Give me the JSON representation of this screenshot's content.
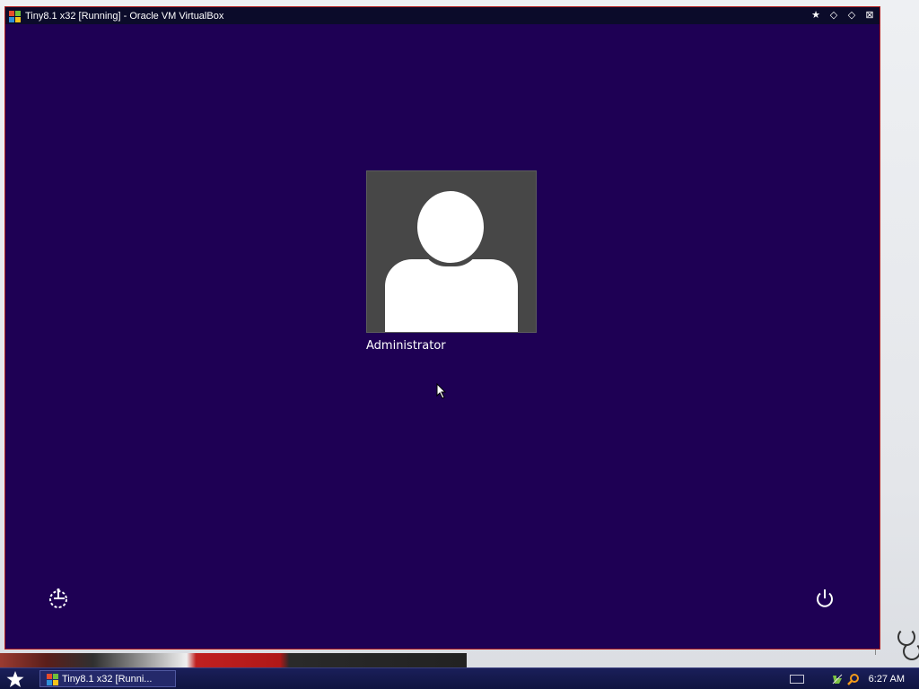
{
  "window": {
    "title": "Tiny8.1 x32 [Running] - Oracle VM VirtualBox",
    "buttons": [
      "pin-icon",
      "minimize-icon",
      "maximize-icon",
      "close-icon"
    ],
    "border_color": "#b11c1c"
  },
  "vm_screen": {
    "background_color": "#1e0054",
    "user": {
      "name": "Administrator",
      "avatar_icon": "user-silhouette-icon"
    },
    "bottom_left_icon": "ease-of-access-icon",
    "bottom_right_icon": "power-icon"
  },
  "taskbar": {
    "start_icon": "start-star-icon",
    "task_label": "Tiny8.1 x32 [Runni...",
    "tray_icons": [
      "keyboard-icon",
      "network-icon",
      "search-icon"
    ],
    "clock": "6:27 AM"
  }
}
